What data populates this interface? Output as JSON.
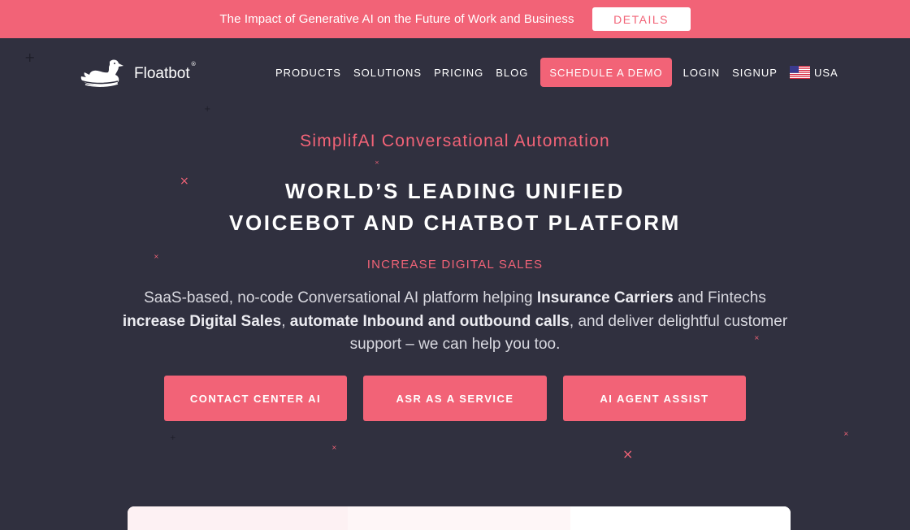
{
  "announcement": {
    "text": "The Impact of Generative AI on the Future of Work and Business",
    "button_label": "DETAILS"
  },
  "brand": {
    "name": "Floatbot",
    "reg_mark": "®",
    "logo_icon": "duck-logo-icon"
  },
  "nav": {
    "items": [
      {
        "label": "PRODUCTS"
      },
      {
        "label": "SOLUTIONS"
      },
      {
        "label": "PRICING"
      },
      {
        "label": "BLOG"
      }
    ],
    "demo_label": "SCHEDULE A DEMO",
    "login_label": "LOGIN",
    "signup_label": "SIGNUP",
    "region_label": "USA",
    "region_icon": "us-flag-icon"
  },
  "hero": {
    "kicker": "SimplifAI Conversational Automation",
    "title_line1": "WORLD’S LEADING UNIFIED",
    "title_line2": "VOICEBOT AND CHATBOT PLATFORM",
    "subheading": "INCREASE DIGITAL SALES",
    "desc": {
      "p1": "SaaS-based, no-code Conversational AI platform helping ",
      "b1": "Insurance Carriers",
      "p2": " and Fintechs ",
      "b2": "increase Digital Sales",
      "p3": ", ",
      "b3": "automate Inbound and outbound calls",
      "p4": ", and deliver delightful customer support – we can help you too."
    },
    "ctas": [
      {
        "label": "CONTACT CENTER AI"
      },
      {
        "label": "ASR AS A SERVICE"
      },
      {
        "label": "AI AGENT ASSIST"
      }
    ]
  },
  "colors": {
    "accent": "#f26377",
    "background": "#30303f",
    "text": "#ffffff"
  }
}
